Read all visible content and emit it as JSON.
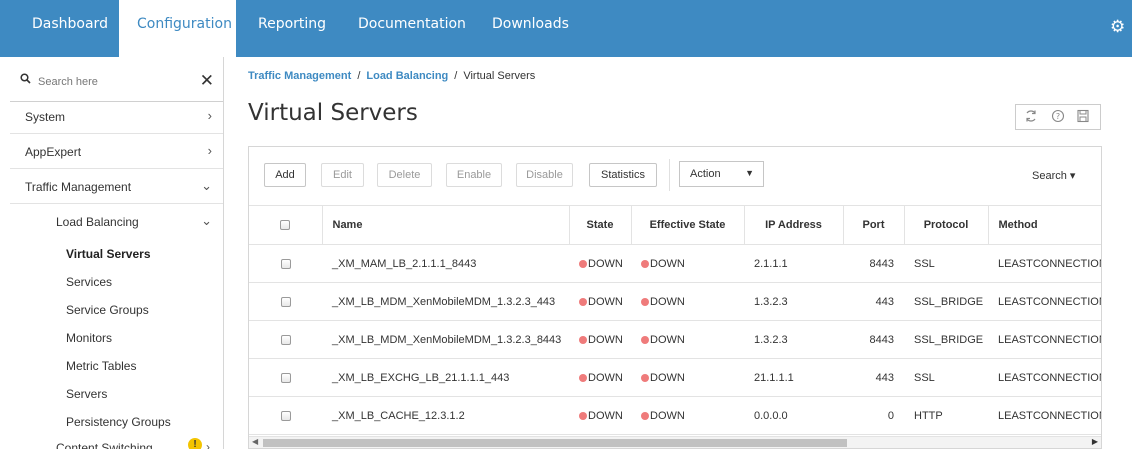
{
  "topnav": {
    "tabs": [
      "Dashboard",
      "Configuration",
      "Reporting",
      "Documentation",
      "Downloads"
    ],
    "active": "Configuration",
    "accent": "#3e8ac2",
    "settings_icon": "gear-icon"
  },
  "sidebar": {
    "search_placeholder": "Search here",
    "items": [
      {
        "label": "System"
      },
      {
        "label": "AppExpert"
      },
      {
        "label": "Traffic Management"
      }
    ],
    "lb_label": "Load Balancing",
    "lb_children": [
      "Virtual Servers",
      "Services",
      "Service Groups",
      "Monitors",
      "Metric Tables",
      "Servers",
      "Persistency Groups"
    ],
    "content_switching": "Content Switching",
    "warning_badge": "!"
  },
  "breadcrumb": {
    "level1": "Traffic Management",
    "level2": "Load Balancing",
    "current": "Virtual Servers",
    "separator": "/"
  },
  "page": {
    "title": "Virtual Servers"
  },
  "toolbar": {
    "add": "Add",
    "edit": "Edit",
    "delete": "Delete",
    "enable": "Enable",
    "disable": "Disable",
    "statistics": "Statistics",
    "action": "Action",
    "search": "Search ▾"
  },
  "table": {
    "headers": [
      "Name",
      "State",
      "Effective State",
      "IP Address",
      "Port",
      "Protocol",
      "Method"
    ],
    "rows": [
      {
        "name": "_XM_MAM_LB_2.1.1.1_8443",
        "state": "DOWN",
        "effective": "DOWN",
        "ip": "2.1.1.1",
        "port": "8443",
        "protocol": "SSL",
        "method": "LEASTCONNECTION"
      },
      {
        "name": "_XM_LB_MDM_XenMobileMDM_1.3.2.3_443",
        "state": "DOWN",
        "effective": "DOWN",
        "ip": "1.3.2.3",
        "port": "443",
        "protocol": "SSL_BRIDGE",
        "method": "LEASTCONNECTION"
      },
      {
        "name": "_XM_LB_MDM_XenMobileMDM_1.3.2.3_8443",
        "state": "DOWN",
        "effective": "DOWN",
        "ip": "1.3.2.3",
        "port": "8443",
        "protocol": "SSL_BRIDGE",
        "method": "LEASTCONNECTION"
      },
      {
        "name": "_XM_LB_EXCHG_LB_21.1.1.1_443",
        "state": "DOWN",
        "effective": "DOWN",
        "ip": "21.1.1.1",
        "port": "443",
        "protocol": "SSL",
        "method": "LEASTCONNECTION"
      },
      {
        "name": "_XM_LB_CACHE_12.3.1.2",
        "state": "DOWN",
        "effective": "DOWN",
        "ip": "0.0.0.0",
        "port": "0",
        "protocol": "HTTP",
        "method": "LEASTCONNECTION"
      }
    ],
    "status_color": "#ef7b7b"
  }
}
